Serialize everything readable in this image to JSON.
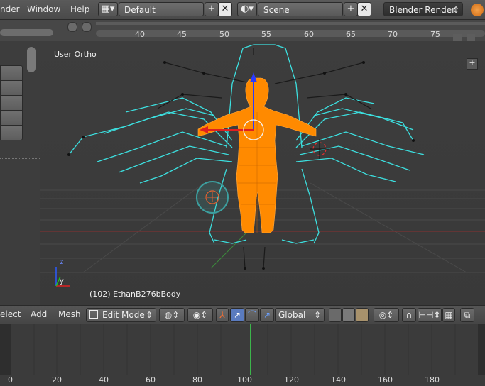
{
  "menubar": {
    "items": [
      "nder",
      "Window",
      "Help"
    ],
    "screen_layout": "Default",
    "scene": "Scene",
    "render_engine": "Blender Render"
  },
  "timeline_top": {
    "ticks": [
      "40",
      "45",
      "50",
      "55",
      "60",
      "65",
      "70",
      "75"
    ]
  },
  "viewport": {
    "view_label": "User Ortho",
    "object_info": "(102) EthanB276bBody",
    "axis_z": "z",
    "axis_y": "y"
  },
  "header3d": {
    "menus": [
      "elect",
      "Add",
      "Mesh"
    ],
    "mode": "Edit Mode",
    "orientation": "Global"
  },
  "timeline_bottom": {
    "ticks": [
      "0",
      "20",
      "40",
      "60",
      "80",
      "100",
      "120",
      "140",
      "160",
      "180"
    ],
    "current_frame": 102
  },
  "colors": {
    "selected_mesh": "#ff8a00",
    "armature_wire": "#3ce0e0",
    "current_frame": "#3cb44b",
    "bg_panel": "#474747"
  }
}
